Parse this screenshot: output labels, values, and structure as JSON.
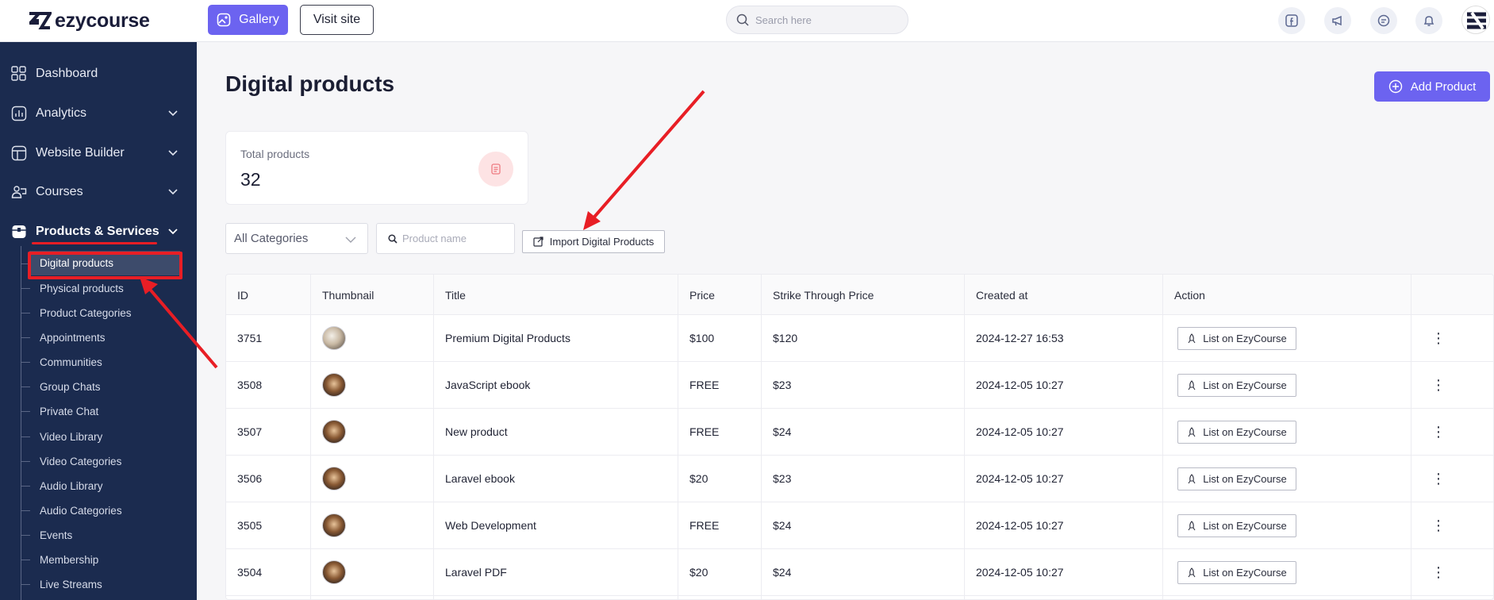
{
  "brand": {
    "name": "ezycourse"
  },
  "topbar": {
    "gallery_label": "Gallery",
    "visit_label": "Visit site",
    "search_placeholder": "Search here"
  },
  "sidebar": {
    "items": [
      {
        "label": "Dashboard",
        "icon": "grid-icon",
        "expandable": false
      },
      {
        "label": "Analytics",
        "icon": "chart-icon",
        "expandable": true
      },
      {
        "label": "Website Builder",
        "icon": "layout-icon",
        "expandable": true
      },
      {
        "label": "Courses",
        "icon": "courses-icon",
        "expandable": true
      },
      {
        "label": "Products & Services",
        "icon": "box-icon",
        "expandable": true,
        "active": true
      }
    ],
    "sub_items": [
      "Digital products",
      "Physical products",
      "Product Categories",
      "Appointments",
      "Communities",
      "Group Chats",
      "Private Chat",
      "Video Library",
      "Video Categories",
      "Audio Library",
      "Audio Categories",
      "Events",
      "Membership",
      "Live Streams"
    ]
  },
  "main": {
    "title": "Digital products",
    "add_label": "Add Product",
    "stat": {
      "label": "Total products",
      "value": "32"
    },
    "filters": {
      "category_value": "All Categories",
      "name_placeholder": "Product name",
      "import_label": "Import Digital Products"
    },
    "table": {
      "columns": [
        "ID",
        "Thumbnail",
        "Title",
        "Price",
        "Strike Through Price",
        "Created at",
        "Action"
      ],
      "action_label": "List on EzyCourse",
      "rows": [
        {
          "id": "3751",
          "title": "Premium Digital Products",
          "price": "$100",
          "strike": "$120",
          "created": "2024-12-27 16:53"
        },
        {
          "id": "3508",
          "title": "JavaScript ebook",
          "price": "FREE",
          "strike": "$23",
          "created": "2024-12-05 10:27"
        },
        {
          "id": "3507",
          "title": "New product",
          "price": "FREE",
          "strike": "$24",
          "created": "2024-12-05 10:27"
        },
        {
          "id": "3506",
          "title": "Laravel ebook",
          "price": "$20",
          "strike": "$23",
          "created": "2024-12-05 10:27"
        },
        {
          "id": "3505",
          "title": "Web Development",
          "price": "FREE",
          "strike": "$24",
          "created": "2024-12-05 10:27"
        },
        {
          "id": "3504",
          "title": "Laravel PDF",
          "price": "$20",
          "strike": "$24",
          "created": "2024-12-05 10:27"
        }
      ]
    }
  },
  "colors": {
    "accent": "#6c63f0",
    "sidebar": "#1b2b4f",
    "annotation": "#e81e25"
  }
}
